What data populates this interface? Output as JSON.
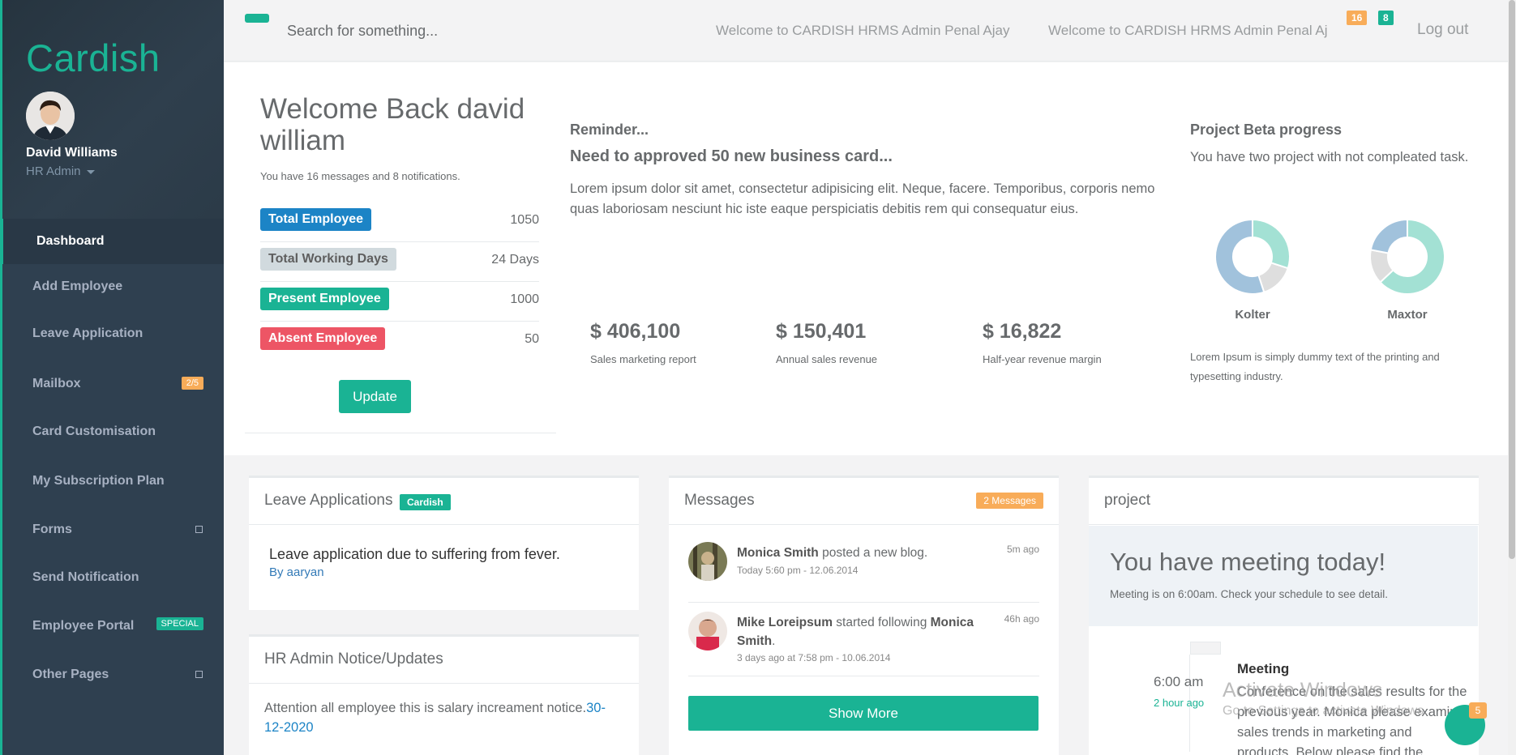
{
  "app": {
    "brand": "Cardish"
  },
  "user": {
    "name": "David Williams",
    "role": "HR Admin"
  },
  "sidebar": {
    "items": [
      {
        "label": "Dashboard"
      },
      {
        "label": "Add Employee"
      },
      {
        "label": "Leave Application"
      },
      {
        "label": "Mailbox",
        "badge": "2/5"
      },
      {
        "label": "Card Customisation"
      },
      {
        "label": "My Subscription Plan"
      },
      {
        "label": "Forms"
      },
      {
        "label": "Send Notification"
      },
      {
        "label": "Employee Portal",
        "badge": "SPECIAL"
      },
      {
        "label": "Other Pages"
      }
    ]
  },
  "topbar": {
    "search_placeholder": "Search for something...",
    "welcome_1": "Welcome to CARDISH HRMS Admin Penal Ajay",
    "welcome_2": "Welcome to CARDISH HRMS Admin Penal Aj",
    "messages_badge": "16",
    "notifications_badge": "8",
    "logout": "Log out"
  },
  "welcome": {
    "title": "Welcome Back david william",
    "subtitle": "You have 16 messages and 8 notifications.",
    "stats": [
      {
        "label": "Total Employee",
        "value": "1050",
        "color": "#1c84c6"
      },
      {
        "label": "Total Working Days",
        "value": "24 Days",
        "color": "#d1dade"
      },
      {
        "label": "Present Employee",
        "value": "1000",
        "color": "#1ab394"
      },
      {
        "label": "Absent Employee",
        "value": "50",
        "color": "#ed5565"
      }
    ],
    "update_label": "Update"
  },
  "reminder": {
    "heading": "Reminder...",
    "subheading": "Need to approved 50 new business card...",
    "text": "Lorem ipsum dolor sit amet, consectetur adipisicing elit. Neque, facere. Temporibus, corporis nemo quas laboriosam nesciunt hic iste eaque perspiciatis debitis rem qui consequatur eius.",
    "metrics": [
      {
        "value": "$ 406,100",
        "label": "Sales marketing report"
      },
      {
        "value": "$ 150,401",
        "label": "Annual sales revenue"
      },
      {
        "value": "$ 16,822",
        "label": "Half-year revenue margin"
      }
    ]
  },
  "project_beta": {
    "title": "Project Beta progress",
    "text": "You have two project with not compleated task.",
    "charts": [
      {
        "name": "Kolter",
        "segments": [
          {
            "value": 30,
            "color": "#a3e1d4"
          },
          {
            "value": 15,
            "color": "#dedede"
          },
          {
            "value": 55,
            "color": "#a1c2dc"
          }
        ]
      },
      {
        "name": "Maxtor",
        "segments": [
          {
            "value": 63,
            "color": "#a3e1d4"
          },
          {
            "value": 15,
            "color": "#dedede"
          },
          {
            "value": 22,
            "color": "#a1c2dc"
          }
        ]
      }
    ],
    "footer": "Lorem Ipsum is simply dummy text of the printing and typesetting industry."
  },
  "leave_applications": {
    "title": "Leave Applications",
    "label": "Cardish",
    "item_title": "Leave application due to suffering from fever.",
    "item_by": "By aaryan"
  },
  "notices": {
    "title": "HR Admin Notice/Updates",
    "text": "Attention all employee this is salary increament notice.",
    "link": "30-12-2020"
  },
  "messages": {
    "title": "Messages",
    "badge": "2 Messages",
    "items": [
      {
        "name": "Monica Smith",
        "action": " posted a new blog.",
        "target": "",
        "time": "Today 5:60 pm - 12.06.2014",
        "ago": "5m ago"
      },
      {
        "name": "Mike Loreipsum",
        "action": " started following ",
        "target": "Monica Smith",
        "time": "3 days ago at 7:58 pm - 10.06.2014",
        "ago": "46h ago"
      }
    ],
    "show_more": "Show More"
  },
  "project": {
    "title": "project",
    "meeting_heading": "You have meeting today!",
    "meeting_text": "Meeting is on 6:00am. Check your schedule to see detail.",
    "timeline": {
      "time": "6:00 am",
      "ago": "2 hour ago",
      "heading": "Meeting",
      "text": "Conference on the sales results for the previous year. Monica please examine sales trends in marketing and products. Below please find the"
    }
  },
  "overlay": {
    "activate_1": "Activate Windows",
    "activate_2": "Go to Settings to activate Windows.",
    "chat_badge": "5"
  }
}
